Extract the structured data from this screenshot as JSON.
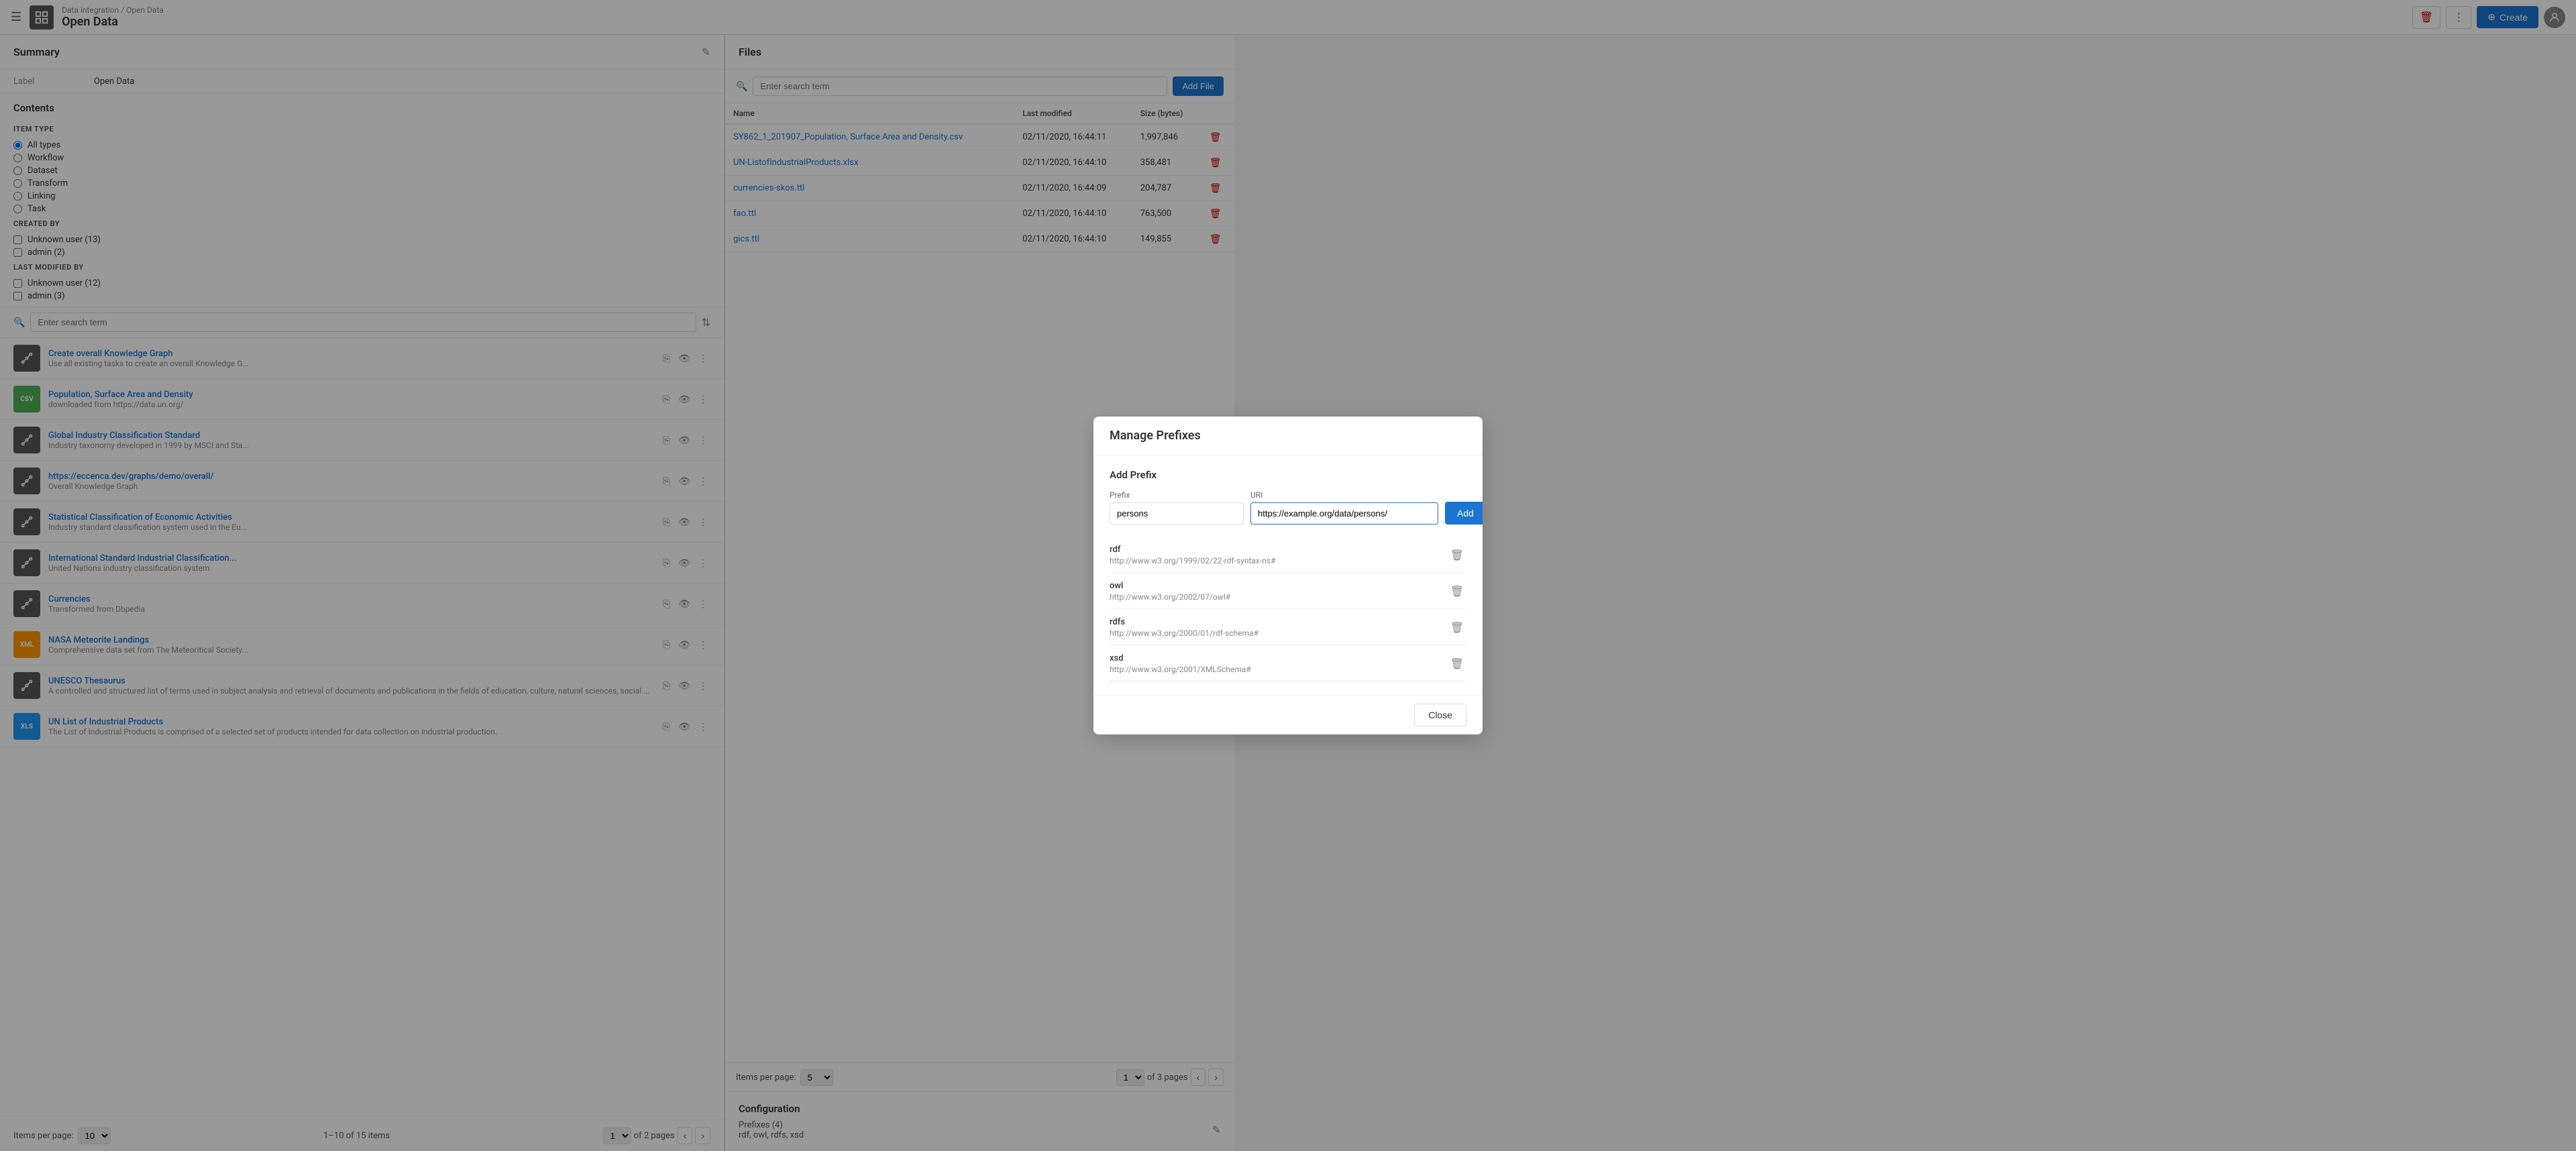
{
  "topbar": {
    "breadcrumb": "Data integration",
    "breadcrumb_separator": "/",
    "page_label": "Open Data",
    "page_title": "Open Data",
    "create_label": "Create",
    "delete_icon": "🗑",
    "more_icon": "⋮",
    "create_icon": "⊕"
  },
  "summary": {
    "title": "Summary",
    "edit_icon": "✎",
    "label_key": "Label",
    "label_value": "Open Data"
  },
  "contents": {
    "title": "Contents",
    "search_placeholder": "Enter search term",
    "item_type_label": "ITEM TYPE",
    "item_types": [
      {
        "id": "all",
        "label": "All types",
        "checked": true
      },
      {
        "id": "workflow",
        "label": "Workflow",
        "checked": false
      },
      {
        "id": "dataset",
        "label": "Dataset",
        "checked": false
      },
      {
        "id": "transform",
        "label": "Transform",
        "checked": false
      },
      {
        "id": "linking",
        "label": "Linking",
        "checked": false
      },
      {
        "id": "task",
        "label": "Task",
        "checked": false
      }
    ],
    "created_by_label": "CREATED BY",
    "created_by_filters": [
      {
        "id": "unk",
        "label": "Unknown user (13)",
        "checked": false
      },
      {
        "id": "adm",
        "label": "admin (2)",
        "checked": false
      }
    ],
    "last_modified_by_label": "LAST MODIFIED BY",
    "last_modified_by_filters": [
      {
        "id": "unk2",
        "label": "Unknown user (12)",
        "checked": false
      },
      {
        "id": "adm2",
        "label": "admin (3)",
        "checked": false
      }
    ],
    "items": [
      {
        "icon_text": "graph",
        "icon_class": "icon-graph",
        "title": "Create overall Knowledge Graph",
        "desc": "Use all existing tasks to create an overall Knowledge G...",
        "type": "graph"
      },
      {
        "icon_text": "CSV",
        "icon_class": "icon-csv",
        "title": "Population, Surface Area and Density",
        "desc": "downloaded from https://data.un.org/",
        "type": "csv"
      },
      {
        "icon_text": "graph",
        "icon_class": "icon-graph",
        "title": "Global Industry Classification Standard",
        "desc": "Industry taxonomy developed in 1999 by MSCI and Sta...",
        "type": "graph"
      },
      {
        "icon_text": "graph",
        "icon_class": "icon-graph",
        "title": "https://eccenca.dev/graphs/demo/overall/",
        "desc": "Overall Knowledge Graph",
        "type": "graph"
      },
      {
        "icon_text": "graph",
        "icon_class": "icon-graph",
        "title": "Statistical Classification of Economic Activities",
        "desc": "Industry standard classification system used in the Eu...",
        "type": "graph"
      },
      {
        "icon_text": "graph",
        "icon_class": "icon-graph",
        "title": "International Standard Industrial Classification...",
        "desc": "United Nations industry classification system",
        "type": "graph"
      },
      {
        "icon_text": "graph",
        "icon_class": "icon-graph",
        "title": "Currencies",
        "desc": "Transformed from Dbpedia",
        "type": "graph"
      },
      {
        "icon_text": "XML",
        "icon_class": "icon-xml",
        "title": "NASA Meteorite Landings",
        "desc": "Comprehensive data set from The Meteoritical Society...",
        "type": "xml"
      },
      {
        "icon_text": "graph",
        "icon_class": "icon-graph",
        "title": "UNESCO Thesaurus",
        "desc": "A controlled and structured list of terms used in subject analysis and retrieval of documents and publications in the fields of education, culture, natural sciences, social ...",
        "type": "graph"
      },
      {
        "icon_text": "XLS",
        "icon_class": "icon-xls",
        "title": "UN List of Industrial Products",
        "desc": "The List of Industrial Products is comprised of a selected set of products intended for data collection on industrial production.",
        "type": "xls"
      }
    ],
    "pagination": {
      "items_per_page_label": "Items per page:",
      "items_per_page_value": "10",
      "range_label": "1–10 of 15 items",
      "page_value": "1",
      "of_pages": "of 2 pages"
    }
  },
  "files": {
    "title": "Files",
    "search_placeholder": "Enter search term",
    "add_file_label": "Add File",
    "columns": {
      "name": "Name",
      "last_modified": "Last modified",
      "size": "Size (bytes)"
    },
    "rows": [
      {
        "name": "SY862_1_201907_Population, Surface Area and Density.csv",
        "last_modified": "02/11/2020, 16:44:11",
        "size": "1,997,846"
      },
      {
        "name": "UN-ListofIndustrialProducts.xlsx",
        "last_modified": "02/11/2020, 16:44:10",
        "size": "358,481"
      },
      {
        "name": "currencies-skos.ttl",
        "last_modified": "02/11/2020, 16:44:09",
        "size": "204,787"
      },
      {
        "name": "fao.ttl",
        "last_modified": "02/11/2020, 16:44:10",
        "size": "763,500"
      },
      {
        "name": "gics.ttl",
        "last_modified": "02/11/2020, 16:44:10",
        "size": "149,855"
      }
    ],
    "pagination": {
      "items_per_page_label": "Items per page:",
      "items_per_page_value": "5",
      "page_value": "1",
      "of_pages": "of 3 pages"
    }
  },
  "configuration": {
    "title": "Configuration",
    "prefixes_label": "Prefixes (4)",
    "prefixes_detail": "rdf, owl, rdfs, xsd",
    "edit_icon": "✎"
  },
  "modal": {
    "title": "Manage Prefixes",
    "section_title": "Add Prefix",
    "prefix_label": "Prefix",
    "uri_label": "URI",
    "prefix_value": "persons",
    "uri_value": "https://example.org/data/persons/",
    "add_button": "Add",
    "prefixes": [
      {
        "name": "rdf",
        "uri": "http://www.w3.org/1999/02/22-rdf-syntax-ns#"
      },
      {
        "name": "owl",
        "uri": "http://www.w3.org/2002/07/owl#"
      },
      {
        "name": "rdfs",
        "uri": "http://www.w3.org/2000/01/rdf-schema#"
      },
      {
        "name": "xsd",
        "uri": "http://www.w3.org/2001/XMLSchema#"
      }
    ],
    "close_label": "Close"
  }
}
